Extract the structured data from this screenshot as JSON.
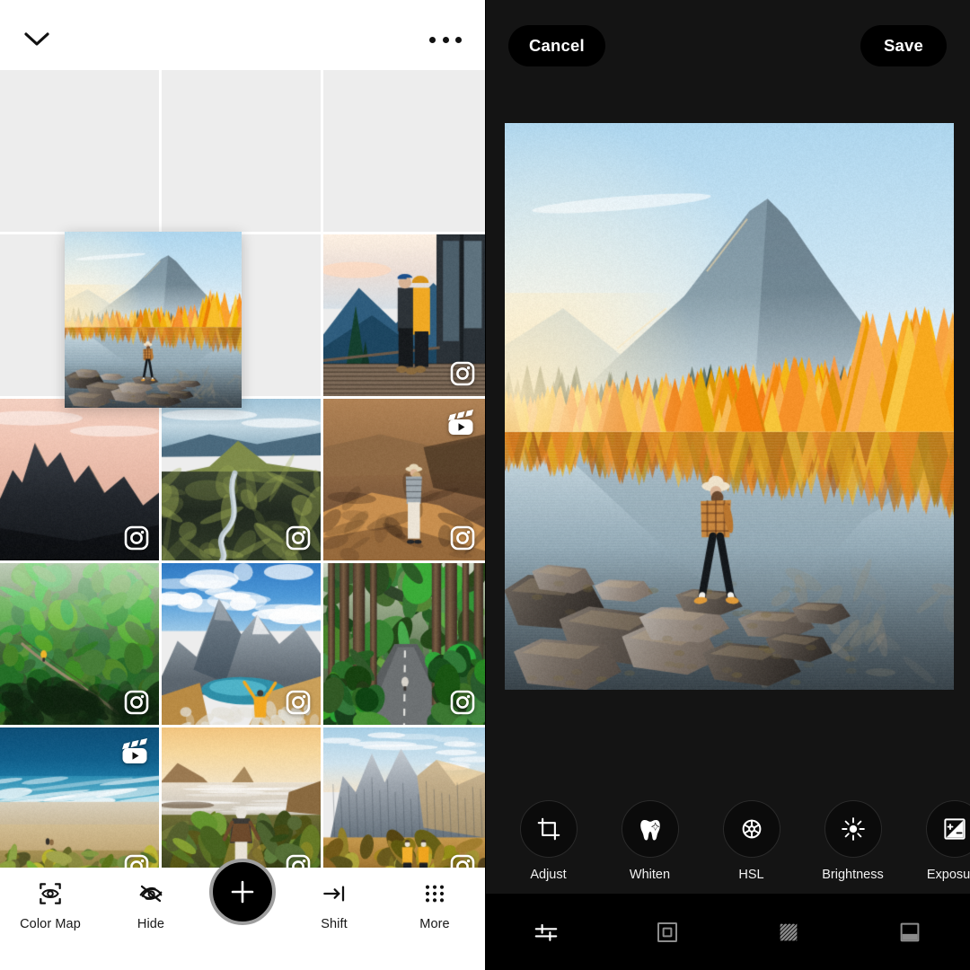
{
  "app": {
    "accent_white": "#ffffff",
    "dark_bg": "#141414",
    "placeholder_gray": "#ededed"
  },
  "left_panel": {
    "header": {
      "collapse_icon": "chevron-down-icon",
      "overflow_icon": "more-horizontal-icon"
    },
    "grid": {
      "columns": 3,
      "rows": 5,
      "cells": [
        {
          "id": "c1",
          "type": "empty",
          "badge": "none",
          "alt": "empty placeholder tile"
        },
        {
          "id": "c2",
          "type": "empty",
          "badge": "none",
          "alt": "empty placeholder tile"
        },
        {
          "id": "c3",
          "type": "empty",
          "badge": "none",
          "alt": "empty placeholder tile"
        },
        {
          "id": "c4",
          "type": "empty",
          "badge": "none",
          "alt": "empty placeholder tile"
        },
        {
          "id": "c5",
          "type": "empty",
          "badge": "none",
          "alt": "empty placeholder tile"
        },
        {
          "id": "c6",
          "type": "photo",
          "badge": "instagram",
          "alt": "couple on cabin deck overlooking lake",
          "art": "deck"
        },
        {
          "id": "c7",
          "type": "photo",
          "badge": "instagram",
          "alt": "dark jagged peak at sunrise",
          "art": "peak"
        },
        {
          "id": "c8",
          "type": "photo",
          "badge": "instagram",
          "alt": "river valley in highlands",
          "art": "valley"
        },
        {
          "id": "c9",
          "type": "photo",
          "badge": "reels",
          "badge2": "instagram",
          "alt": "hiker on canyon ridge",
          "art": "canyon"
        },
        {
          "id": "c10",
          "type": "photo",
          "badge": "instagram",
          "alt": "suspension bridge in green rainforest",
          "art": "rainforest"
        },
        {
          "id": "c11",
          "type": "photo",
          "badge": "instagram",
          "alt": "person cheering before snowy mountain and blue lake",
          "art": "snowpeak"
        },
        {
          "id": "c12",
          "type": "photo",
          "badge": "instagram",
          "alt": "road through tall redwood forest",
          "art": "redwood"
        },
        {
          "id": "c13",
          "type": "photo",
          "badge": "reels",
          "badge2": "instagram",
          "alt": "aerial beach and turquoise surf",
          "art": "beach"
        },
        {
          "id": "c14",
          "type": "photo",
          "badge": "instagram",
          "alt": "person walking to ocean at golden hour",
          "art": "coast"
        },
        {
          "id": "c15",
          "type": "photo",
          "badge": "instagram",
          "alt": "two hikers at Seceda ridge",
          "art": "seceda"
        }
      ]
    },
    "drag_tile": {
      "alt": "dragged thumbnail of mountain lake reflection photo",
      "art": "lake"
    },
    "toolbar": {
      "items": [
        {
          "label": "Color Map",
          "icon": "color-map-icon"
        },
        {
          "label": "Hide",
          "icon": "eye-off-icon"
        },
        {
          "label": "Shift",
          "icon": "shift-arrow-icon"
        },
        {
          "label": "More",
          "icon": "grid-dots-icon"
        }
      ],
      "add_button": {
        "icon": "plus-icon",
        "label": "Add"
      }
    }
  },
  "right_panel": {
    "topbar": {
      "cancel_label": "Cancel",
      "save_label": "Save"
    },
    "preview": {
      "alt": "woman in plaid jacket stepping across stones on a mirror-still alpine lake with golden larch forest and mountain",
      "art": "lake"
    },
    "tools": [
      {
        "label": "Adjust",
        "icon": "crop-icon"
      },
      {
        "label": "Whiten",
        "icon": "tooth-icon"
      },
      {
        "label": "HSL",
        "icon": "color-wheel-icon"
      },
      {
        "label": "Brightness",
        "icon": "sun-icon"
      },
      {
        "label": "Exposure",
        "icon": "exposure-icon"
      }
    ],
    "tabs": [
      {
        "icon": "sliders-icon",
        "active": true
      },
      {
        "icon": "frame-icon",
        "active": false
      },
      {
        "icon": "texture-icon",
        "active": false
      },
      {
        "icon": "gradient-icon",
        "active": false
      }
    ]
  }
}
